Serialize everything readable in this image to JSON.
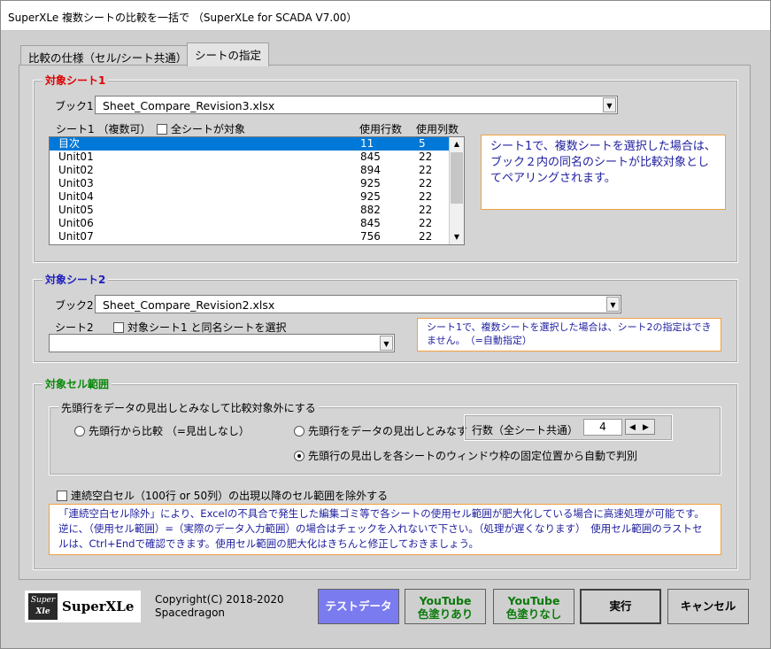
{
  "window": {
    "title": "SuperXLe 複数シートの比較を一括で （SuperXLe for SCADA V7.00）"
  },
  "tabs": [
    {
      "label": "比較の仕様（セル/シート共通）"
    },
    {
      "label": "シートの指定"
    }
  ],
  "sheet1": {
    "legend": "対象シート1",
    "legend_color": "#e00000",
    "book_label": "ブック1",
    "book_value": "Sheet_Compare_Revision3.xlsx",
    "list_label": "シート1 （複数可）",
    "all_sheets_label": "全シートが対象",
    "col_rows": "使用行数",
    "col_cols": "使用列数",
    "rows": [
      {
        "name": "目次",
        "rows": "11",
        "cols": "5"
      },
      {
        "name": "Unit01",
        "rows": "845",
        "cols": "22"
      },
      {
        "name": "Unit02",
        "rows": "894",
        "cols": "22"
      },
      {
        "name": "Unit03",
        "rows": "925",
        "cols": "22"
      },
      {
        "name": "Unit04",
        "rows": "925",
        "cols": "22"
      },
      {
        "name": "Unit05",
        "rows": "882",
        "cols": "22"
      },
      {
        "name": "Unit06",
        "rows": "845",
        "cols": "22"
      },
      {
        "name": "Unit07",
        "rows": "756",
        "cols": "22"
      }
    ],
    "note": "シート1で、複数シートを選択した場合は、ブック２内の同名のシートが比較対象としてペアリングされます。"
  },
  "sheet2": {
    "legend": "対象シート2",
    "legend_color": "#2020c0",
    "book_label": "ブック2",
    "book_value": "Sheet_Compare_Revision2.xlsx",
    "sheet_label": "シート2",
    "same_name_label": "対象シート1 と同名シートを選択",
    "sheet_value": "",
    "note": "シート1で、複数シートを選択した場合は、シート2の指定はできません。　（=自動指定）"
  },
  "cellrange": {
    "legend": "対象セル範囲",
    "legend_color": "#0a8a0a",
    "header_group_label": "先頭行をデータの見出しとみなして比較対象外にする",
    "radio1": "先頭行から比較 （=見出しなし）",
    "radio2": "先頭行をデータの見出しとみなす",
    "radio3": "先頭行の見出しを各シートのウィンドウ枠の固定位置から自動で判別",
    "rows_label": "行数（全シート共通）",
    "rows_value": "4",
    "exclude_label": "連続空白セル（100行 or 50列）の出現以降のセル範囲を除外する",
    "note": "「連続空白セル除外」により、Excelの不具合で発生した編集ゴミ等で各シートの使用セル範囲が肥大化している場合に高速処理が可能です。逆に、（使用セル範囲）=（実際のデータ入力範囲）の場合はチェックを入れないで下さい。（処理が遅くなります）　使用セル範囲のラストセルは、Ctrl+Endで確認できます。使用セル範囲の肥大化はきちんと修正しておきましょう。"
  },
  "footer": {
    "logo_small_top": "Super",
    "logo_small_bottom": "Xle",
    "logo_text": "SuperXLe",
    "copyright_line1": "Copyright(C) 2018-2020",
    "copyright_line2": "Spacedragon",
    "test_data": "テストデータ",
    "yt1_line1": "YouTube",
    "yt1_line2": "色塗りあり",
    "yt2_line1": "YouTube",
    "yt2_line2": "色塗りなし",
    "run": "実行",
    "cancel": "キャンセル"
  }
}
